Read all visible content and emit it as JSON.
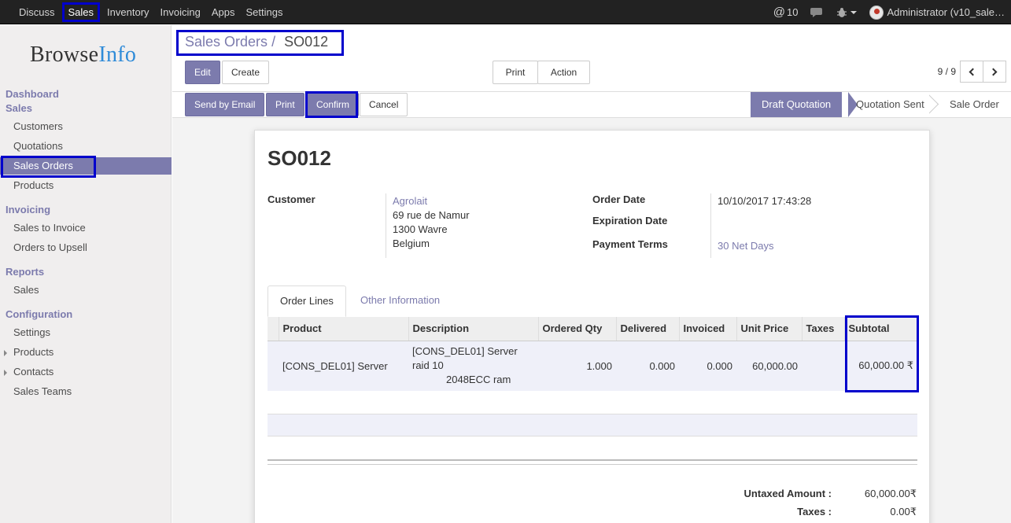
{
  "topbar": {
    "menu": [
      "Discuss",
      "Sales",
      "Inventory",
      "Invoicing",
      "Apps",
      "Settings"
    ],
    "active_menu": "Sales",
    "messages_count": "10",
    "user": "Administrator (v10_sale…"
  },
  "sidebar": {
    "logo_browse": "Browse",
    "logo_info": "Info",
    "dashboard": "Dashboard",
    "sales_head": "Sales",
    "sales_items": [
      "Customers",
      "Quotations",
      "Sales Orders",
      "Products"
    ],
    "invoicing_head": "Invoicing",
    "invoicing_items": [
      "Sales to Invoice",
      "Orders to Upsell"
    ],
    "reports_head": "Reports",
    "reports_items": [
      "Sales"
    ],
    "config_head": "Configuration",
    "config_items": [
      "Settings",
      "Products",
      "Contacts",
      "Sales Teams"
    ]
  },
  "breadcrumb": {
    "parent": "Sales Orders",
    "sep": "/",
    "current": "SO012"
  },
  "buttons": {
    "edit": "Edit",
    "create": "Create",
    "print_menu": "Print",
    "action_menu": "Action",
    "send_email": "Send by Email",
    "print": "Print",
    "confirm": "Confirm",
    "cancel": "Cancel"
  },
  "pager": "9 / 9",
  "stages": [
    "Draft Quotation",
    "Quotation Sent",
    "Sale Order"
  ],
  "active_stage": "Draft Quotation",
  "form": {
    "title": "SO012",
    "customer_label": "Customer",
    "customer_name": "Agrolait",
    "customer_addr1": "69 rue de Namur",
    "customer_addr2": "1300 Wavre",
    "customer_addr3": "Belgium",
    "order_date_label": "Order Date",
    "order_date": "10/10/2017 17:43:28",
    "expiration_label": "Expiration Date",
    "expiration_date": "",
    "payment_terms_label": "Payment Terms",
    "payment_terms": "30 Net Days"
  },
  "tabs": [
    "Order Lines",
    "Other Information"
  ],
  "lines": {
    "headers": [
      "Product",
      "Description",
      "Ordered Qty",
      "Delivered",
      "Invoiced",
      "Unit Price",
      "Taxes",
      "Subtotal"
    ],
    "rows": [
      {
        "product": "[CONS_DEL01] Server",
        "desc1": "[CONS_DEL01] Server",
        "desc2": "raid 10",
        "desc3": "2048ECC ram",
        "qty": "1.000",
        "delivered": "0.000",
        "invoiced": "0.000",
        "unit_price": "60,000.00",
        "taxes": "",
        "subtotal": "60,000.00 ₹"
      }
    ]
  },
  "totals": {
    "untaxed_label": "Untaxed Amount :",
    "untaxed": "60,000.00₹",
    "taxes_label": "Taxes :",
    "taxes": "0.00₹"
  },
  "colors": {
    "brand": "#7c7bad",
    "highlight": "#0000cc",
    "topbar": "#222222"
  }
}
